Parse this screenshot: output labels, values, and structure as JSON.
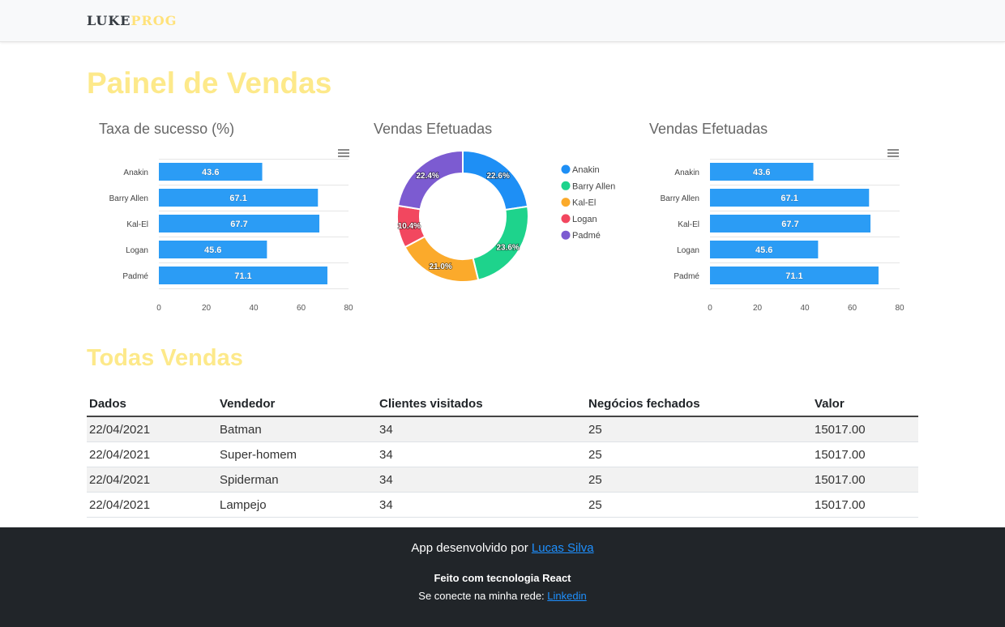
{
  "brand": {
    "part1": "LUKE",
    "part2": "PROG"
  },
  "page_title": "Painel de Vendas",
  "section_title": "Todas Vendas",
  "charts": {
    "bar1_title": "Taxa de sucesso (%)",
    "donut_title": "Vendas Efetuadas",
    "bar2_title": "Vendas Efetuadas"
  },
  "colors": {
    "bar": "#2b9cf5",
    "brand_yellow": "#fde98a",
    "footer_bg": "#212529"
  },
  "chart_data": [
    {
      "type": "bar",
      "orientation": "horizontal",
      "title": "Taxa de sucesso (%)",
      "categories": [
        "Anakin",
        "Barry Allen",
        "Kal-El",
        "Logan",
        "Padmé"
      ],
      "values": [
        43.6,
        67.1,
        67.7,
        45.6,
        71.1
      ],
      "xlim": [
        0,
        80
      ],
      "xticks": [
        0,
        20,
        40,
        60,
        80
      ],
      "color": "#2b9cf5",
      "data_labels": true,
      "grid": true
    },
    {
      "type": "pie",
      "donut": true,
      "title": "Vendas Efetuadas",
      "labels": [
        "Anakin",
        "Barry Allen",
        "Kal-El",
        "Logan",
        "Padmé"
      ],
      "values": [
        22.6,
        23.6,
        21.0,
        10.4,
        22.4
      ],
      "colors": [
        "#1e8ff5",
        "#1ed38c",
        "#fbaa2b",
        "#f2475f",
        "#7c5bd1"
      ],
      "legend": "right"
    },
    {
      "type": "bar",
      "orientation": "horizontal",
      "title": "Vendas Efetuadas",
      "categories": [
        "Anakin",
        "Barry Allen",
        "Kal-El",
        "Logan",
        "Padmé"
      ],
      "values": [
        43.6,
        67.1,
        67.7,
        45.6,
        71.1
      ],
      "xlim": [
        0,
        80
      ],
      "xticks": [
        0,
        20,
        40,
        60,
        80
      ],
      "color": "#2b9cf5",
      "data_labels": true,
      "grid": true
    }
  ],
  "table": {
    "headers": [
      "Dados",
      "Vendedor",
      "Clientes visitados",
      "Negócios fechados",
      "Valor"
    ],
    "rows": [
      [
        "22/04/2021",
        "Batman",
        "34",
        "25",
        "15017.00"
      ],
      [
        "22/04/2021",
        "Super-homem",
        "34",
        "25",
        "15017.00"
      ],
      [
        "22/04/2021",
        "Spiderman",
        "34",
        "25",
        "15017.00"
      ],
      [
        "22/04/2021",
        "Lampejo",
        "34",
        "25",
        "15017.00"
      ]
    ]
  },
  "footer": {
    "dev_prefix": "App desenvolvido por ",
    "dev_link": "Lucas Silva",
    "tech": "Feito com tecnologia React",
    "social_prefix": "Se conecte na minha rede: ",
    "social_link": "Linkedin"
  },
  "icons": {
    "chart_menu": "hamburger-menu-icon"
  }
}
